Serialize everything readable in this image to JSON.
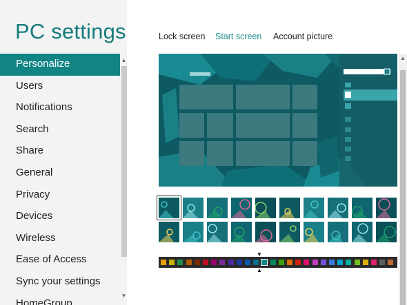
{
  "app": {
    "title": "PC settings"
  },
  "sidebar": {
    "items": [
      {
        "label": "Personalize",
        "selected": true
      },
      {
        "label": "Users"
      },
      {
        "label": "Notifications"
      },
      {
        "label": "Search"
      },
      {
        "label": "Share"
      },
      {
        "label": "General"
      },
      {
        "label": "Privacy"
      },
      {
        "label": "Devices"
      },
      {
        "label": "Wireless"
      },
      {
        "label": "Ease of Access"
      },
      {
        "label": "Sync your settings"
      },
      {
        "label": "HomeGroup"
      }
    ]
  },
  "tabs": [
    {
      "label": "Lock screen"
    },
    {
      "label": "Start screen",
      "active": true
    },
    {
      "label": "Account picture"
    }
  ],
  "theme": {
    "accent": "#128484",
    "background": "#0e5a62"
  },
  "patterns": {
    "count": 20,
    "selected_index": 0
  },
  "colors": [
    "#e8a000",
    "#c8b000",
    "#1e8c4a",
    "#b05a00",
    "#7a2a00",
    "#c01020",
    "#a0006a",
    "#7a2a9a",
    "#4a2aa0",
    "#1a3aa0",
    "#0a5ab0",
    "#00708a",
    "#0e8a8a",
    "#008a5a",
    "#3aa000",
    "#e06a00",
    "#d02010",
    "#e01070",
    "#c040c0",
    "#7a50e0",
    "#3a7ae0",
    "#00a0d0",
    "#00b0a0",
    "#70c020",
    "#e0b000",
    "#e02070",
    "#606060",
    "#c06a30"
  ],
  "selected_color_index": 12
}
